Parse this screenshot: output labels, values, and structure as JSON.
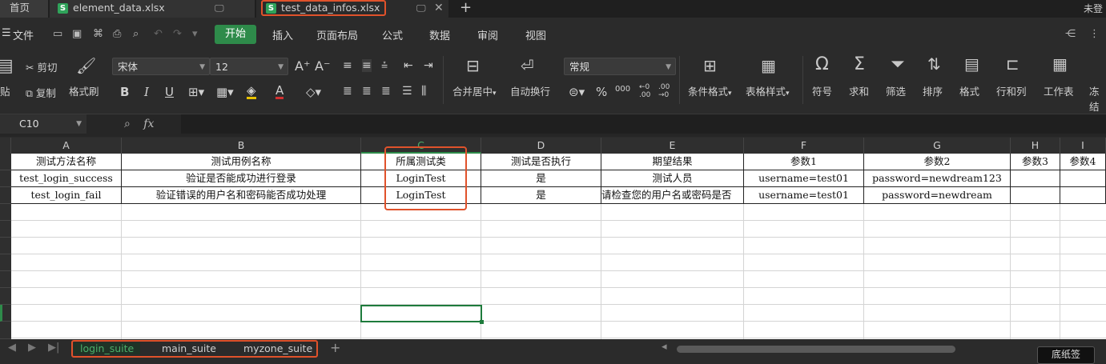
{
  "tabs": {
    "home": "首页",
    "file1": "element_data.xlsx",
    "file2": "test_data_infos.xlsx",
    "login": "未登"
  },
  "menu": {
    "file": "文件",
    "items": [
      "开始",
      "插入",
      "页面布局",
      "公式",
      "数据",
      "审阅",
      "视图"
    ]
  },
  "ribbon": {
    "paste": "贴",
    "cut": "剪切",
    "copy": "复制",
    "format_painter": "格式刷",
    "font_name": "宋体",
    "font_size": "12",
    "bold": "B",
    "italic": "I",
    "underline": "U",
    "merge_center": "合并居中",
    "wrap_text": "自动换行",
    "number_format": "常规",
    "percent": "%",
    "thousands": "000",
    "cond_format": "条件格式",
    "table_style": "表格样式",
    "symbol": "符号",
    "sum": "求和",
    "filter": "筛选",
    "sort": "排序",
    "format": "格式",
    "rowcol": "行和列",
    "sheet": "工作表",
    "freeze": "冻结"
  },
  "formula": {
    "name_box": "C10",
    "fx": "fx"
  },
  "columns": [
    "A",
    "B",
    "C",
    "D",
    "E",
    "F",
    "G",
    "H",
    "I"
  ],
  "rows": [
    [
      "测试方法名称",
      "测试用例名称",
      "所属测试类",
      "测试是否执行",
      "期望结果",
      "参数1",
      "参数2",
      "参数3",
      "参数4"
    ],
    [
      "test_login_success",
      "验证是否能成功进行登录",
      "LoginTest",
      "是",
      "测试人员",
      "username=test01",
      "password=newdream123",
      "",
      ""
    ],
    [
      "test_login_fail",
      "验证错误的用户名和密码能否成功处理",
      "LoginTest",
      "是",
      "请检查您的用户名或密码是否",
      "username=test01",
      "password=newdream",
      "",
      ""
    ]
  ],
  "sheets": [
    "login_suite",
    "main_suite",
    "myzone_suite"
  ],
  "bottom_button": "底纸签",
  "colors": {
    "accent_green": "#2e8b4a",
    "highlight_red": "#e0522b"
  }
}
